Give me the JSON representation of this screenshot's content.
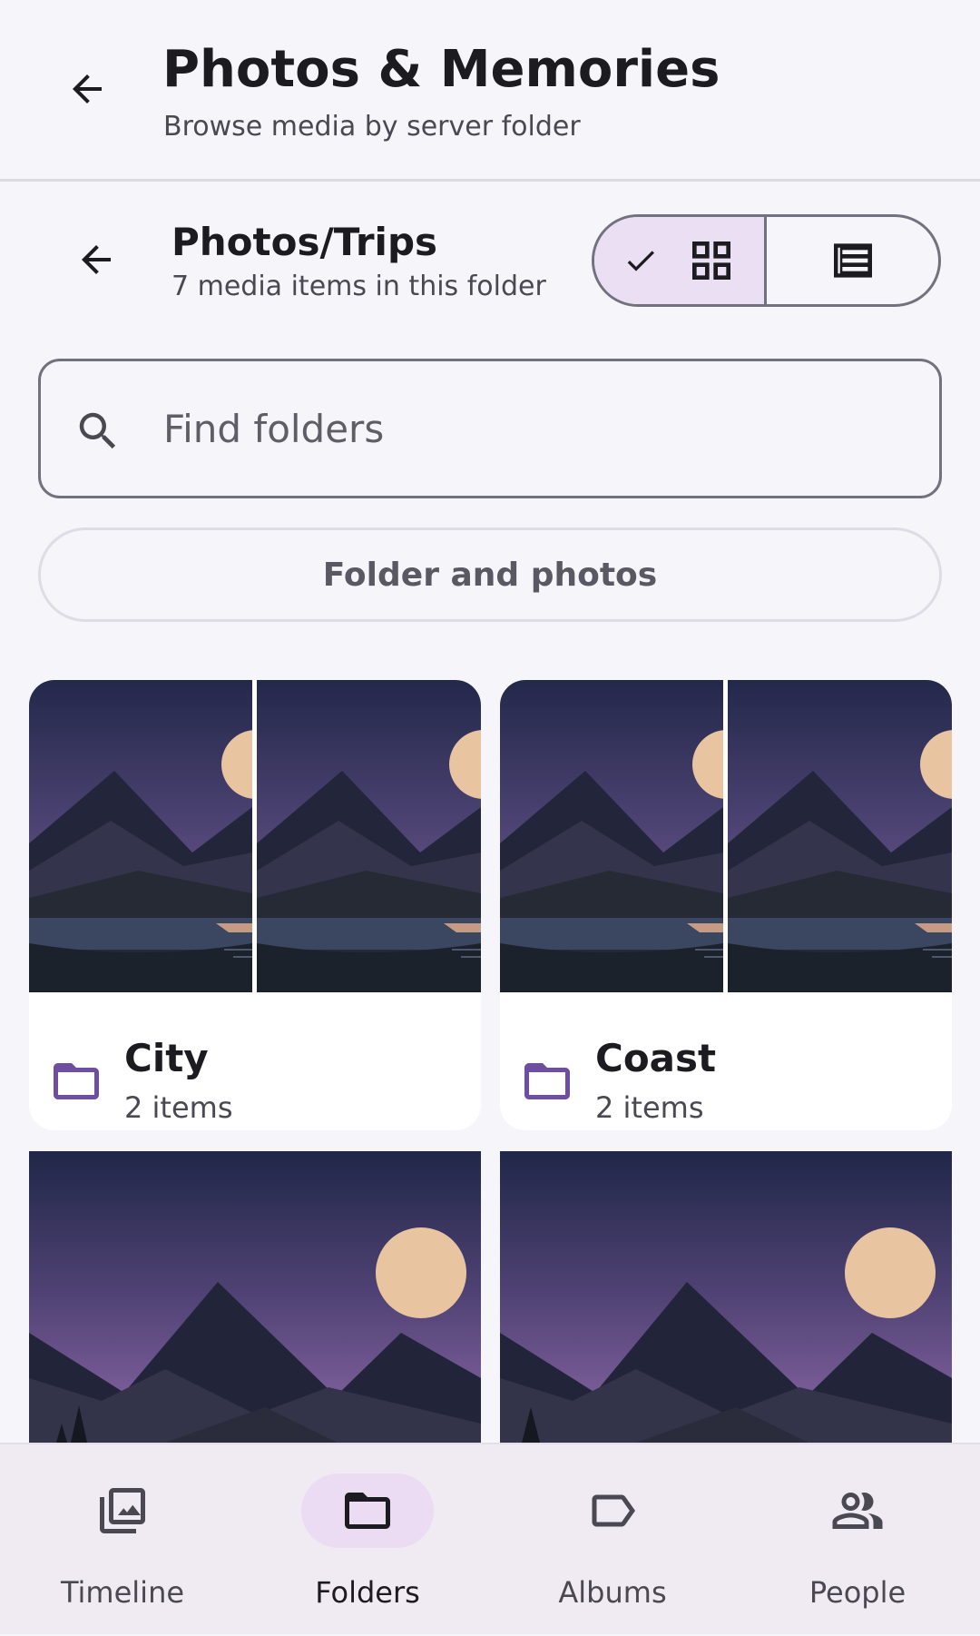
{
  "header": {
    "title": "Photos & Memories",
    "subtitle": "Browse media by server folder"
  },
  "folder": {
    "path": "Photos/Trips",
    "summary": "7 media items in this folder"
  },
  "view_toggle": {
    "options": [
      "grid",
      "list"
    ],
    "selected": "grid"
  },
  "search": {
    "placeholder": "Find folders",
    "value": ""
  },
  "filter": {
    "label": "Folder and photos"
  },
  "folders": [
    {
      "name": "City",
      "count": "2 items"
    },
    {
      "name": "Coast",
      "count": "2 items"
    }
  ],
  "colors": {
    "accent": "#6e4ea0",
    "selected_bg": "#ebdff4",
    "nav_active_bg": "#ebdcf3"
  },
  "bottom_nav": {
    "items": [
      {
        "label": "Timeline",
        "icon": "photo-library-icon"
      },
      {
        "label": "Folders",
        "icon": "folder-icon"
      },
      {
        "label": "Albums",
        "icon": "label-icon"
      },
      {
        "label": "People",
        "icon": "people-icon"
      }
    ],
    "active": "Folders"
  }
}
